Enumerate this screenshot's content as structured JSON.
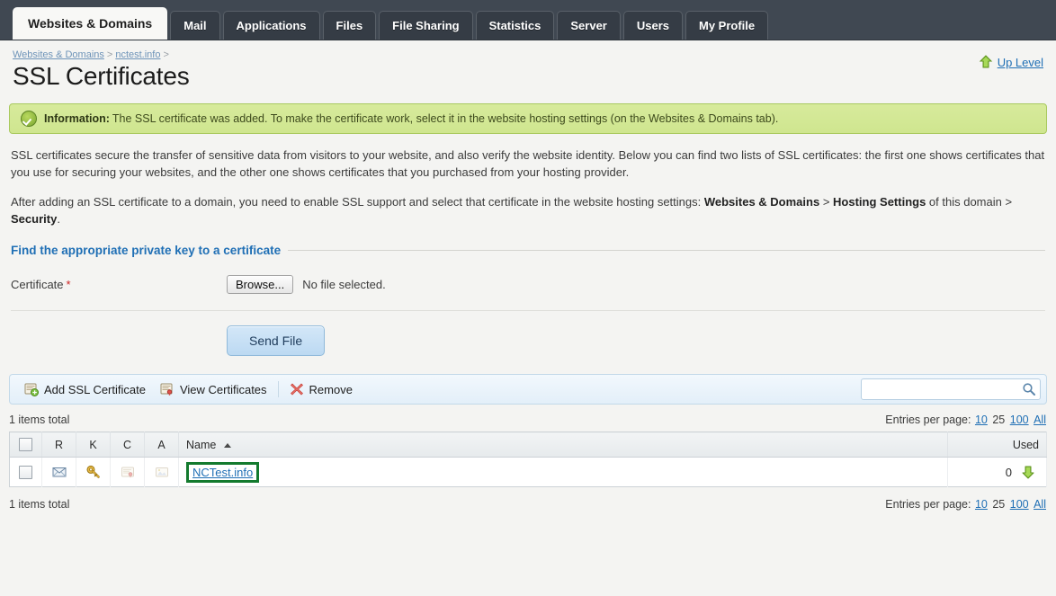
{
  "tabs": [
    {
      "label": "Websites & Domains",
      "active": true
    },
    {
      "label": "Mail",
      "active": false
    },
    {
      "label": "Applications",
      "active": false
    },
    {
      "label": "Files",
      "active": false
    },
    {
      "label": "File Sharing",
      "active": false
    },
    {
      "label": "Statistics",
      "active": false
    },
    {
      "label": "Server",
      "active": false
    },
    {
      "label": "Users",
      "active": false
    },
    {
      "label": "My Profile",
      "active": false
    }
  ],
  "breadcrumb": {
    "item1": "Websites & Domains",
    "sep1": ">",
    "item2": "nctest.info",
    "sep2": ">"
  },
  "header": {
    "title": "SSL Certificates",
    "up_level": "Up Level"
  },
  "info": {
    "label": "Information:",
    "message": "The SSL certificate was added. To make the certificate work, select it in the website hosting settings (on the Websites & Domains tab)."
  },
  "intro": {
    "paragraph1": "SSL certificates secure the transfer of sensitive data from visitors to your website, and also verify the website identity. Below you can find two lists of SSL certificates: the first one shows certificates that you use for securing your websites, and the other one shows certificates that you purchased from your hosting provider.",
    "paragraph2_a": "After adding an SSL certificate to a domain, you need to enable SSL support and select that certificate in the website hosting settings: ",
    "paragraph2_b": "Websites & Domains",
    "paragraph2_c": " > ",
    "paragraph2_d": "Hosting Settings",
    "paragraph2_e": " of this domain > ",
    "paragraph2_f": "Security",
    "paragraph2_g": ".",
    "section_link": "Find the appropriate private key to a certificate"
  },
  "form": {
    "certificate_label": "Certificate",
    "required_mark": "*",
    "browse_button": "Browse...",
    "no_file_text": "No file selected.",
    "send_button": "Send File"
  },
  "toolbar": {
    "add_ssl": "Add SSL Certificate",
    "view_certificates": "View Certificates",
    "remove": "Remove",
    "search_value": "",
    "search_placeholder": ""
  },
  "list": {
    "items_total_top": "1 items total",
    "items_total_bottom": "1 items total",
    "entries_label": "Entries per page:",
    "entries_options": [
      "10",
      "25",
      "100",
      "All"
    ],
    "entries_selected": "25"
  },
  "table": {
    "columns": {
      "select": "",
      "r": "R",
      "k": "K",
      "c": "C",
      "a": "A",
      "name": "Name",
      "used": "Used"
    },
    "sort_column": "Name",
    "sort_direction": "asc",
    "rows": [
      {
        "name": "NCTest.info",
        "used": "0",
        "r_icon": "envelope-icon",
        "k_icon": "key-icon",
        "c_icon": "certificate-icon-disabled",
        "a_icon": "ca-certificate-icon-disabled",
        "used_icon": "green-down-arrow-icon",
        "highlighted": true
      }
    ]
  },
  "colors": {
    "tabbar_bg": "#404852",
    "link": "#1f6fb5",
    "info_bg": "#d4e898",
    "highlight_border": "#137a2e",
    "accent_blue": "#bcd9f2"
  }
}
